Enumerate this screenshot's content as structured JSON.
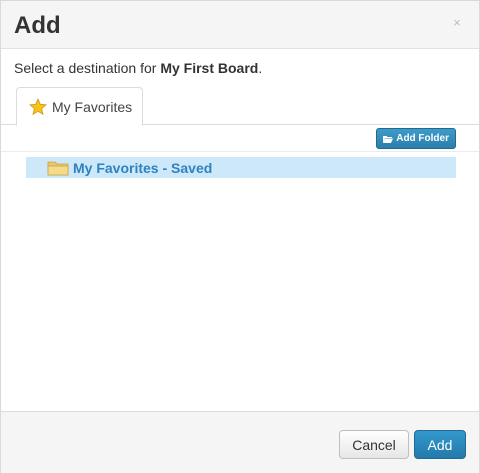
{
  "dialog": {
    "title": "Add",
    "close_glyph": "×",
    "description_prefix": "Select a destination for ",
    "board_name": "My First Board",
    "description_suffix": "."
  },
  "tabs": [
    {
      "label": "My Favorites",
      "icon": "star-icon",
      "active": true
    }
  ],
  "toolbar": {
    "add_folder_label": "Add Folder",
    "add_folder_icon": "folder-open-icon"
  },
  "tree": {
    "items": [
      {
        "label": "My Favorites - Saved",
        "icon": "folder-icon",
        "selected": true
      }
    ]
  },
  "footer": {
    "cancel_label": "Cancel",
    "add_label": "Add"
  },
  "colors": {
    "primary": "#2b86b8",
    "selected_row": "#cde8f8",
    "link_text": "#2f82c0"
  }
}
